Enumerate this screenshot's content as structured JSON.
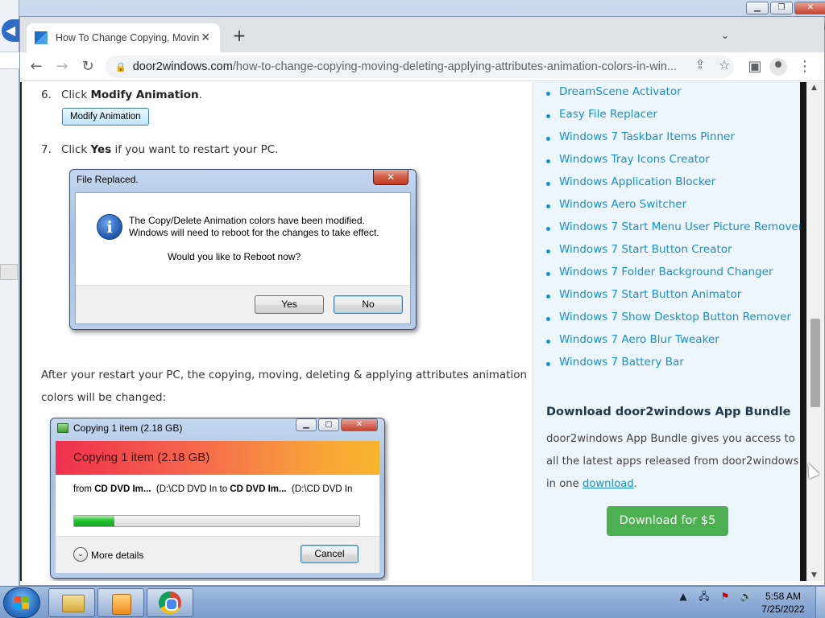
{
  "browser": {
    "tab_title": "How To Change Copying, Moving",
    "url_domain": "door2windows.com",
    "url_path": "/how-to-change-copying-moving-deleting-applying-attributes-animation-colors-in-win...",
    "tab_close": "✕",
    "new_tab": "+",
    "tab_search": "⌄"
  },
  "outer_window": {
    "min": "▁",
    "max": "❐",
    "close": "✕"
  },
  "article": {
    "step6_num": "6.",
    "step6_text_pre": "Click ",
    "step6_text_bold": "Modify Animation",
    "step6_text_post": ".",
    "modify_button_label": "Modify Animation",
    "step7_num": "7.",
    "step7_text_pre": "Click ",
    "step7_text_bold": "Yes",
    "step7_text_post": " if you want to restart your PC.",
    "after_line1": "After your restart your PC, the copying, moving, deleting & applying attributes animation",
    "after_line2": "colors will be changed:"
  },
  "file_replaced_dialog": {
    "title": "File Replaced.",
    "close": "✕",
    "icon": "i",
    "line1": "The Copy/Delete Animation colors have been modified.",
    "line2": "Windows will need to reboot for the changes to take effect.",
    "question": "Would you like to Reboot now?",
    "yes_label": "Yes",
    "no_label": "No"
  },
  "copy_dialog": {
    "title": "Copying 1 item (2.18 GB)",
    "banner": "Copying 1 item (2.18 GB)",
    "from_label": "from",
    "source_name": "CD DVD Im...",
    "source_path": "(D:\\CD DVD In",
    "to_label": "to",
    "dest_name": "CD DVD Im...",
    "dest_path": "(D:\\CD DVD In",
    "progress_fraction": 0.14,
    "more_details": "More details",
    "cancel_label": "Cancel",
    "close": "✕",
    "min": "▁",
    "max": "▢",
    "chevron": "⌄"
  },
  "sidebar": {
    "links": [
      "DreamScene Activator",
      "Easy File Replacer",
      "Windows 7 Taskbar Items Pinner",
      "Windows Tray Icons Creator",
      "Windows Application Blocker",
      "Windows Aero Switcher",
      "Windows 7 Start Menu User Picture Remover",
      "Windows 7 Start Button Creator",
      "Windows 7 Folder Background Changer",
      "Windows 7 Start Button Animator",
      "Windows 7 Show Desktop Button Remover",
      "Windows 7 Aero Blur Tweaker",
      "Windows 7 Battery Bar"
    ],
    "bundle_heading": "Download door2windows App Bundle",
    "bundle_line1": "door2windows App Bundle gives you access to",
    "bundle_line2": "all the latest apps released from door2windows",
    "bundle_line3_pre": "in one ",
    "bundle_link": "download",
    "bundle_line3_post": ".",
    "download_button": "Download for $5"
  },
  "taskbar": {
    "clock_time": "5:58 AM",
    "clock_date": "7/25/2022"
  },
  "colors": {
    "link": "#1a8fc4",
    "download_button": "#4caf50",
    "sidebar_bg": "#edf6fc"
  }
}
